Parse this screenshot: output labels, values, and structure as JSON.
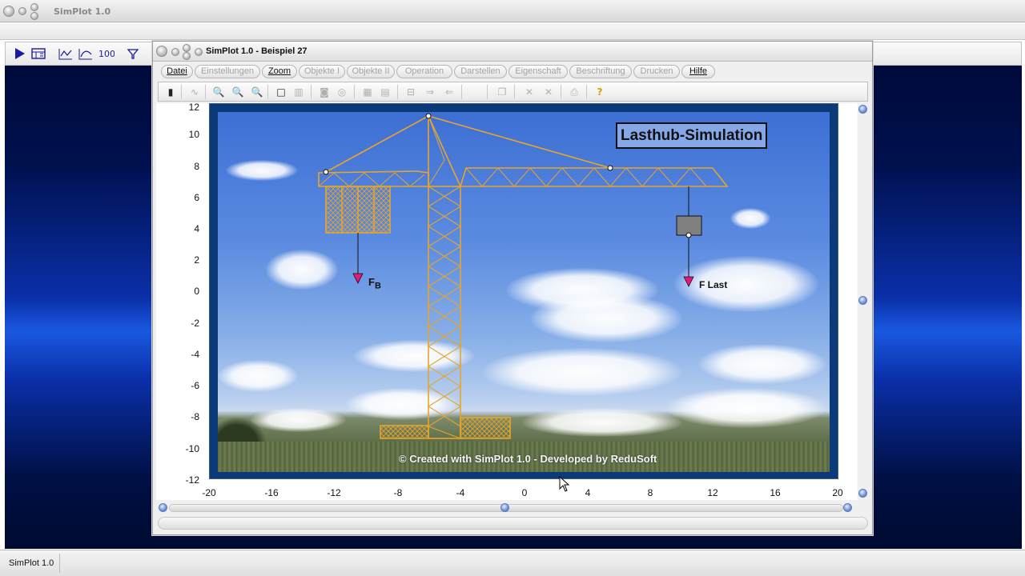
{
  "outer_window": {
    "title": "SimPlot 1.0",
    "status_text": "SimPlot 1.0",
    "toolbar_icons": [
      "play-icon",
      "table-icon",
      "line-chart-icon",
      "xy-chart-icon",
      "chart-100-icon",
      "filter-icon"
    ]
  },
  "inner_window": {
    "title": "SimPlot 1.0 - Beispiel 27",
    "menu": [
      {
        "label": "Datei",
        "enabled": true
      },
      {
        "label": "Einstellungen",
        "enabled": false
      },
      {
        "label": "Zoom",
        "enabled": true
      },
      {
        "label": "Objekte I",
        "enabled": false
      },
      {
        "label": "Objekte II",
        "enabled": false
      },
      {
        "label": "Operation",
        "enabled": false
      },
      {
        "label": "Darstellen",
        "enabled": false
      },
      {
        "label": "Eigenschaft",
        "enabled": false
      },
      {
        "label": "Beschriftung",
        "enabled": false
      },
      {
        "label": "Drucken",
        "enabled": false
      },
      {
        "label": "Hilfe",
        "enabled": true
      }
    ],
    "toolbar_icons": [
      "calculator-icon",
      "curve-icon",
      "zoom-out-icon",
      "zoom-icon",
      "zoom-in-icon",
      "rectangle-icon",
      "multi-rect-icon",
      "circle-icon",
      "circle-double-icon",
      "grid-icon",
      "table-edit-icon",
      "align-icon",
      "arrow-right-icon",
      "arrow-left-icon",
      "copy-icon",
      "delete-icon",
      "delete-all-icon",
      "print-icon",
      "help-icon"
    ]
  },
  "plot": {
    "y_ticks": [
      "12",
      "10",
      "8",
      "6",
      "4",
      "2",
      "0",
      "-2",
      "-4",
      "-6",
      "-8",
      "-10",
      "-12"
    ],
    "x_ticks": [
      "-20",
      "-16",
      "-12",
      "-8",
      "-4",
      "0",
      "4",
      "8",
      "12",
      "16",
      "20"
    ],
    "title": "Lasthub-Simulation",
    "force_b_label": "F",
    "force_b_sub": "B",
    "force_load_label": "F Last",
    "credit": "© Created with SimPlot 1.0 - Developed by ReduSoft"
  },
  "colors": {
    "crane": "#e6a52c",
    "force_arrow": "#e0197a",
    "load_box": "#808080",
    "frame": "#0c3a78"
  }
}
